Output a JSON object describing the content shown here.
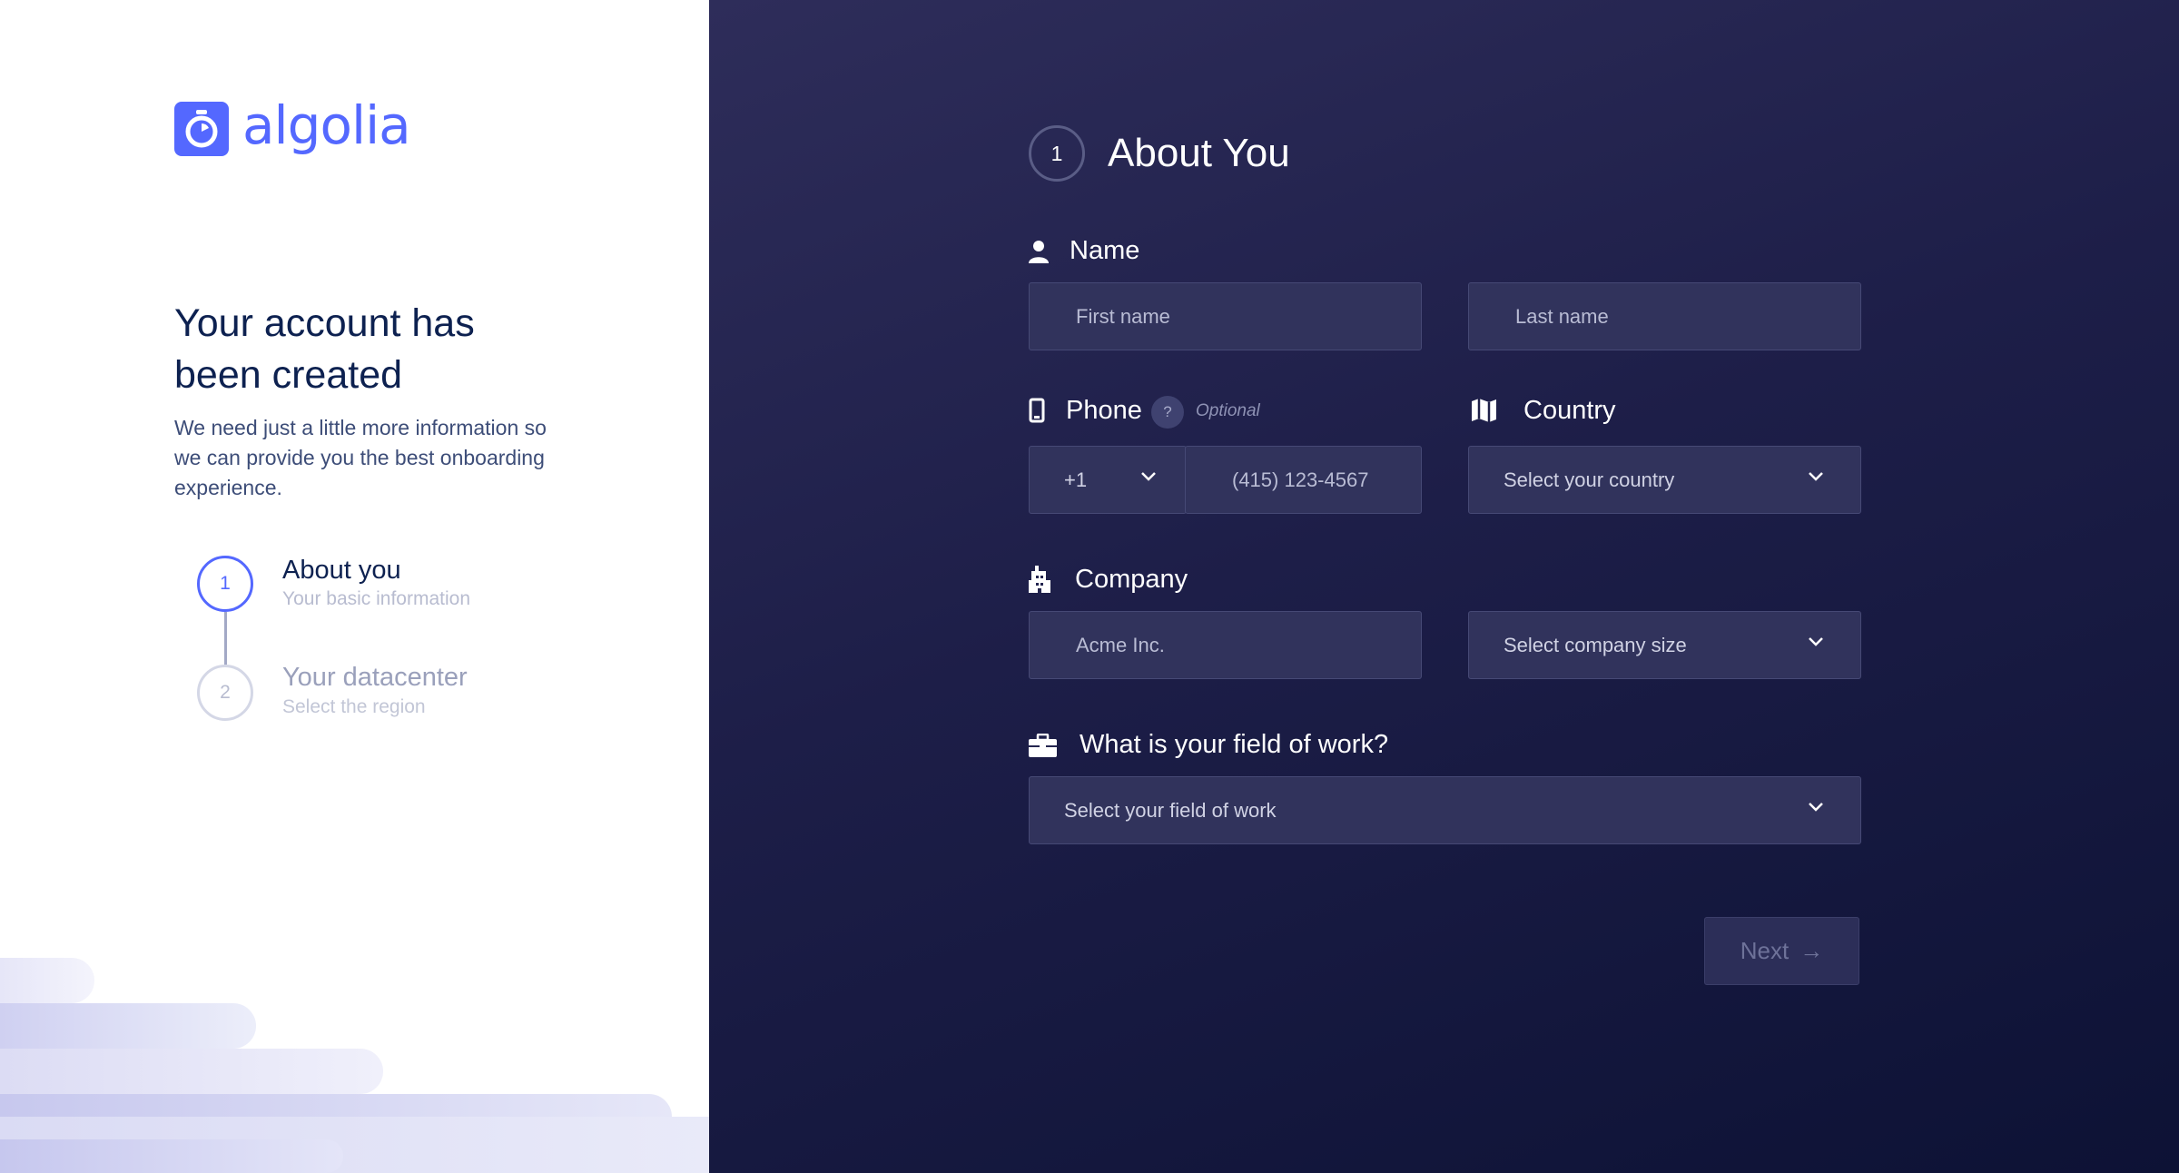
{
  "brand": {
    "name": "algolia",
    "color": "#5468ff"
  },
  "left": {
    "headline": "Your account has been created",
    "subtext": "We need just a little more information so we can provide you the best onboarding experience.",
    "steps": [
      {
        "number": "1",
        "title": "About you",
        "subtitle": "Your basic information",
        "state": "active"
      },
      {
        "number": "2",
        "title": "Your datacenter",
        "subtitle": "Select the region",
        "state": "inactive"
      }
    ]
  },
  "form": {
    "step_number": "1",
    "title": "About You",
    "name": {
      "label": "Name",
      "first_placeholder": "First name",
      "last_placeholder": "Last name"
    },
    "phone": {
      "label": "Phone",
      "help": "?",
      "optional": "Optional",
      "country_code": "+1",
      "placeholder": "(415) 123-4567"
    },
    "country": {
      "label": "Country",
      "value": "Select your country"
    },
    "company": {
      "label": "Company",
      "placeholder": "Acme Inc.",
      "size_value": "Select company size"
    },
    "field_of_work": {
      "label": "What is your field of work?",
      "value": "Select your field of work"
    },
    "next_label": "Next",
    "next_arrow": "→"
  }
}
